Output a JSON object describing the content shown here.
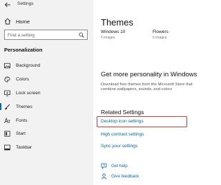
{
  "window": {
    "title": "Settings"
  },
  "sidebar": {
    "home_label": "Home",
    "search_placeholder": "Find a setting",
    "section_title": "Personalization",
    "items": [
      {
        "label": "Background",
        "icon": "image-icon"
      },
      {
        "label": "Colors",
        "icon": "palette-icon"
      },
      {
        "label": "Lock screen",
        "icon": "lock-screen-icon"
      },
      {
        "label": "Themes",
        "icon": "brush-icon"
      },
      {
        "label": "Fonts",
        "icon": "fonts-icon"
      },
      {
        "label": "Start",
        "icon": "start-icon"
      },
      {
        "label": "Taskbar",
        "icon": "taskbar-icon"
      }
    ],
    "active_item": "Themes"
  },
  "main": {
    "title": "Themes",
    "themes": [
      {
        "name": "Windows 10",
        "count": "5 images"
      },
      {
        "name": "Flowers",
        "count": "6 images"
      }
    ],
    "more_title": "Get more personality in Windows",
    "more_desc": "Download free themes from the Microsoft Store that combine wallpapers, sounds, and colors",
    "related_title": "Related Settings",
    "related_links": [
      {
        "label": "Desktop icon settings",
        "highlighted": true
      },
      {
        "label": "High contrast settings"
      },
      {
        "label": "Sync your settings"
      }
    ],
    "help": [
      {
        "label": "Get help",
        "icon": "help-icon"
      },
      {
        "label": "Give feedback",
        "icon": "feedback-icon"
      }
    ]
  },
  "colors": {
    "accent": "#0067c0",
    "link": "#0067b8",
    "highlight": "#e0352b",
    "sidebar_bg": "#f2f2f2"
  }
}
